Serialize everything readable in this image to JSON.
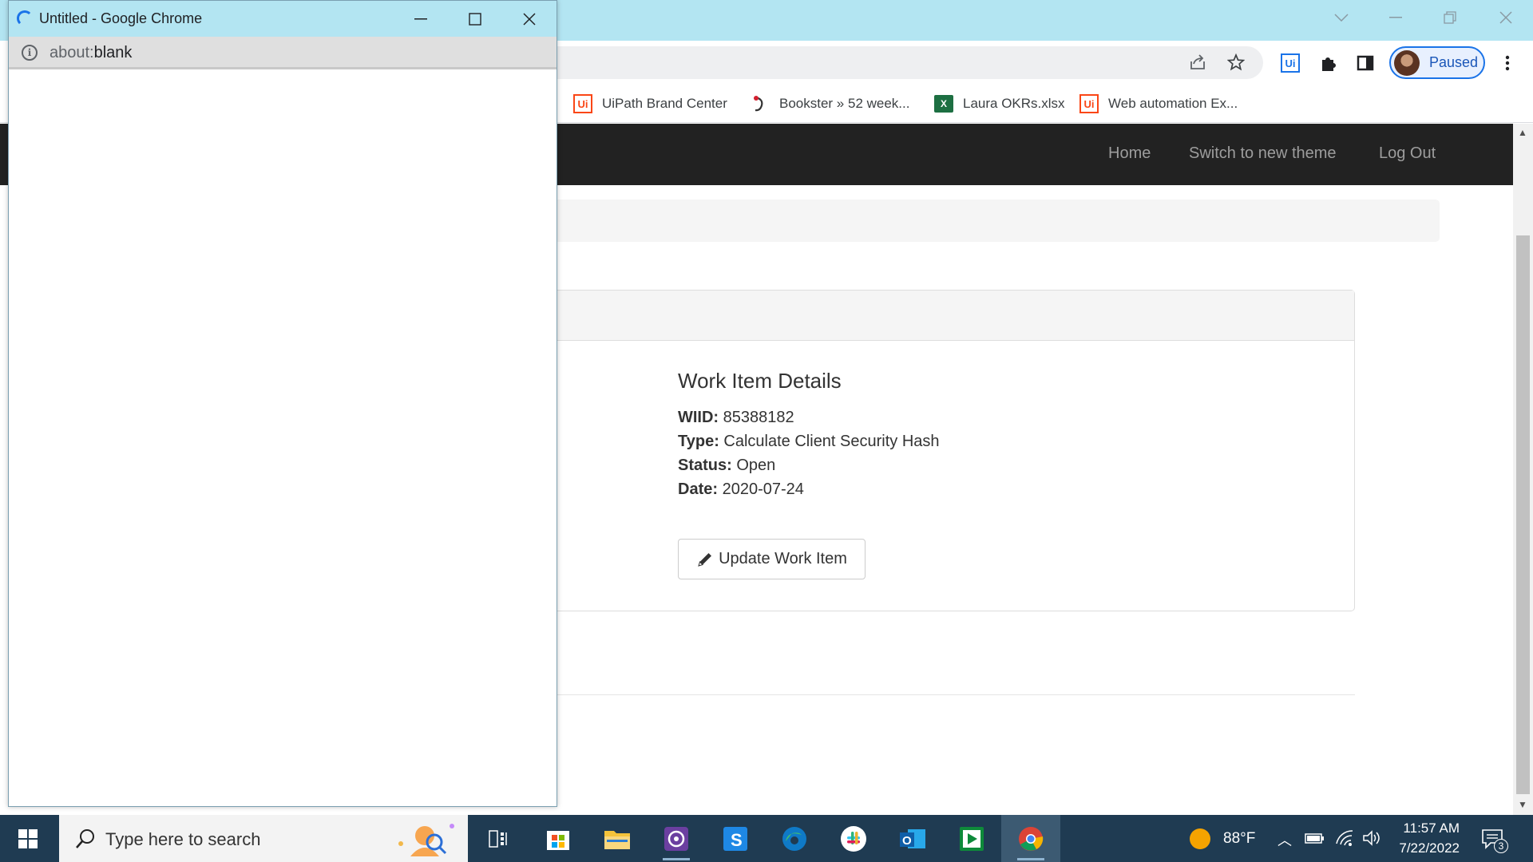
{
  "main_window": {
    "profile_label": "Paused",
    "bookmarks": [
      {
        "label": "UiPath Brand Center",
        "icon": "uipath-icon"
      },
      {
        "label": "Bookster » 52 week...",
        "icon": "bookster-icon"
      },
      {
        "label": "Laura OKRs.xlsx",
        "icon": "excel-icon"
      },
      {
        "label": "Web automation Ex...",
        "icon": "uipath-icon"
      }
    ]
  },
  "site_nav": {
    "links": [
      "Home",
      "Switch to new theme",
      "Log Out"
    ]
  },
  "work_item": {
    "title": "Work Item Details",
    "fields": [
      {
        "label": "WIID:",
        "value": "85388182"
      },
      {
        "label": "Type:",
        "value": "Calculate Client Security Hash"
      },
      {
        "label": "Status:",
        "value": "Open"
      },
      {
        "label": "Date:",
        "value": "2020-07-24"
      }
    ],
    "update_button": "Update Work Item"
  },
  "popup": {
    "title": "Untitled - Google Chrome",
    "url_scheme": "about:",
    "url_host": "blank"
  },
  "taskbar": {
    "search_placeholder": "Type here to search",
    "temperature": "88°F",
    "time": "11:57 AM",
    "date": "7/22/2022",
    "notification_count": "3"
  },
  "colors": {
    "titlebar": "#b3e5f2",
    "nav_bg": "#222222",
    "taskbar_bg": "#1f3b52",
    "accent_blue": "#1a73e8",
    "uipath_orange": "#fa4616"
  }
}
